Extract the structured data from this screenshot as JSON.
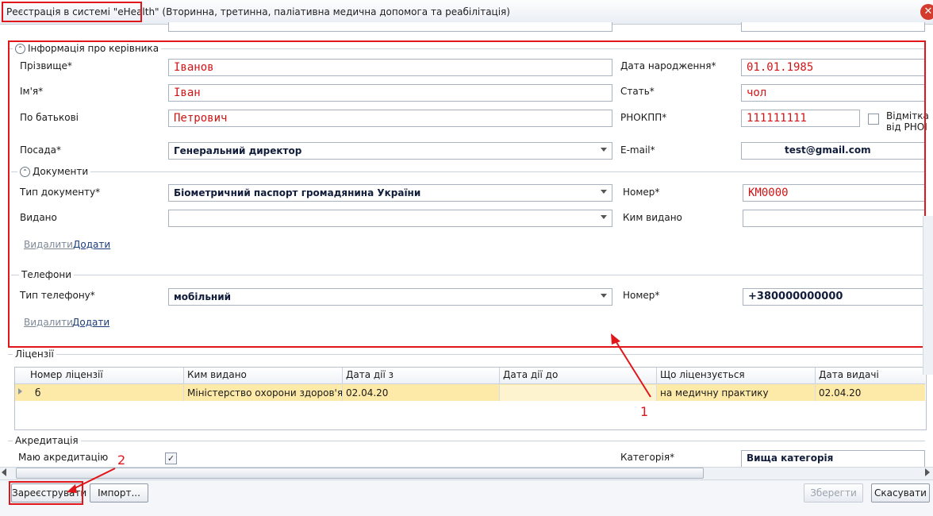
{
  "window": {
    "title_part1": "Реєстрація в системі \"eHealth\"",
    "title_part2": " (Вторинна, третинна, паліативна медична допомога та реабілітація)",
    "close_glyph": "✕"
  },
  "manager": {
    "group_title": "Інформація про керівника",
    "surname_label": "Прізвище*",
    "surname_value": "Іванов",
    "name_label": "Ім'я*",
    "name_value": "Іван",
    "patronymic_label": "По батькові",
    "patronymic_value": "Петрович",
    "position_label": "Посада*",
    "position_value": "Генеральний директор",
    "birth_label": "Дата народження*",
    "birth_value": "01.01.1985",
    "gender_label": "Стать*",
    "gender_value": "чол",
    "rnokpp_label": "РНОКПП*",
    "rnokpp_value": "111111111",
    "refusal_label_1": "Відмітка",
    "refusal_label_2": "від РНОІ",
    "email_label": "E-mail*",
    "email_value": "test@gmail.com"
  },
  "documents": {
    "group_title": "Документи",
    "type_label": "Тип документу*",
    "type_value": "Біометричний паспорт громадянина України",
    "issued_label": "Видано",
    "issued_value": "",
    "number_label": "Номер*",
    "number_value": "КМ0000",
    "issued_by_label": "Ким видано",
    "issued_by_value": "",
    "delete_link": "Видалити",
    "add_link": "Додати"
  },
  "phones": {
    "group_title": "Телефони",
    "type_label": "Тип телефону*",
    "type_value": "мобільний",
    "number_label": "Номер*",
    "number_value": "+380000000000",
    "delete_link": "Видалити",
    "add_link": "Додати"
  },
  "licenses": {
    "group_title": "Ліцензії",
    "columns": [
      "Номер ліцензії",
      "Ким видано",
      "Дата дії з",
      "Дата дії до",
      "Що ліцензується",
      "Дата видачі"
    ],
    "rows": [
      [
        "б",
        "Міністерство охорони здоров'я...",
        "02.04.20",
        "",
        "на медичну практику",
        "02.04.20"
      ]
    ]
  },
  "accreditation": {
    "group_title": "Акредитація",
    "has_label": "Маю акредитацію",
    "checked": true,
    "category_label": "Категорія*",
    "category_value": "Вища категорія"
  },
  "annotations": {
    "marker_1": "1",
    "marker_2": "2",
    "color": "#e0161b"
  },
  "footer": {
    "register_button": "Зареєструвати",
    "import_button": "Імпорт...",
    "save_button": "Зберегти",
    "cancel_button": "Скасувати"
  }
}
